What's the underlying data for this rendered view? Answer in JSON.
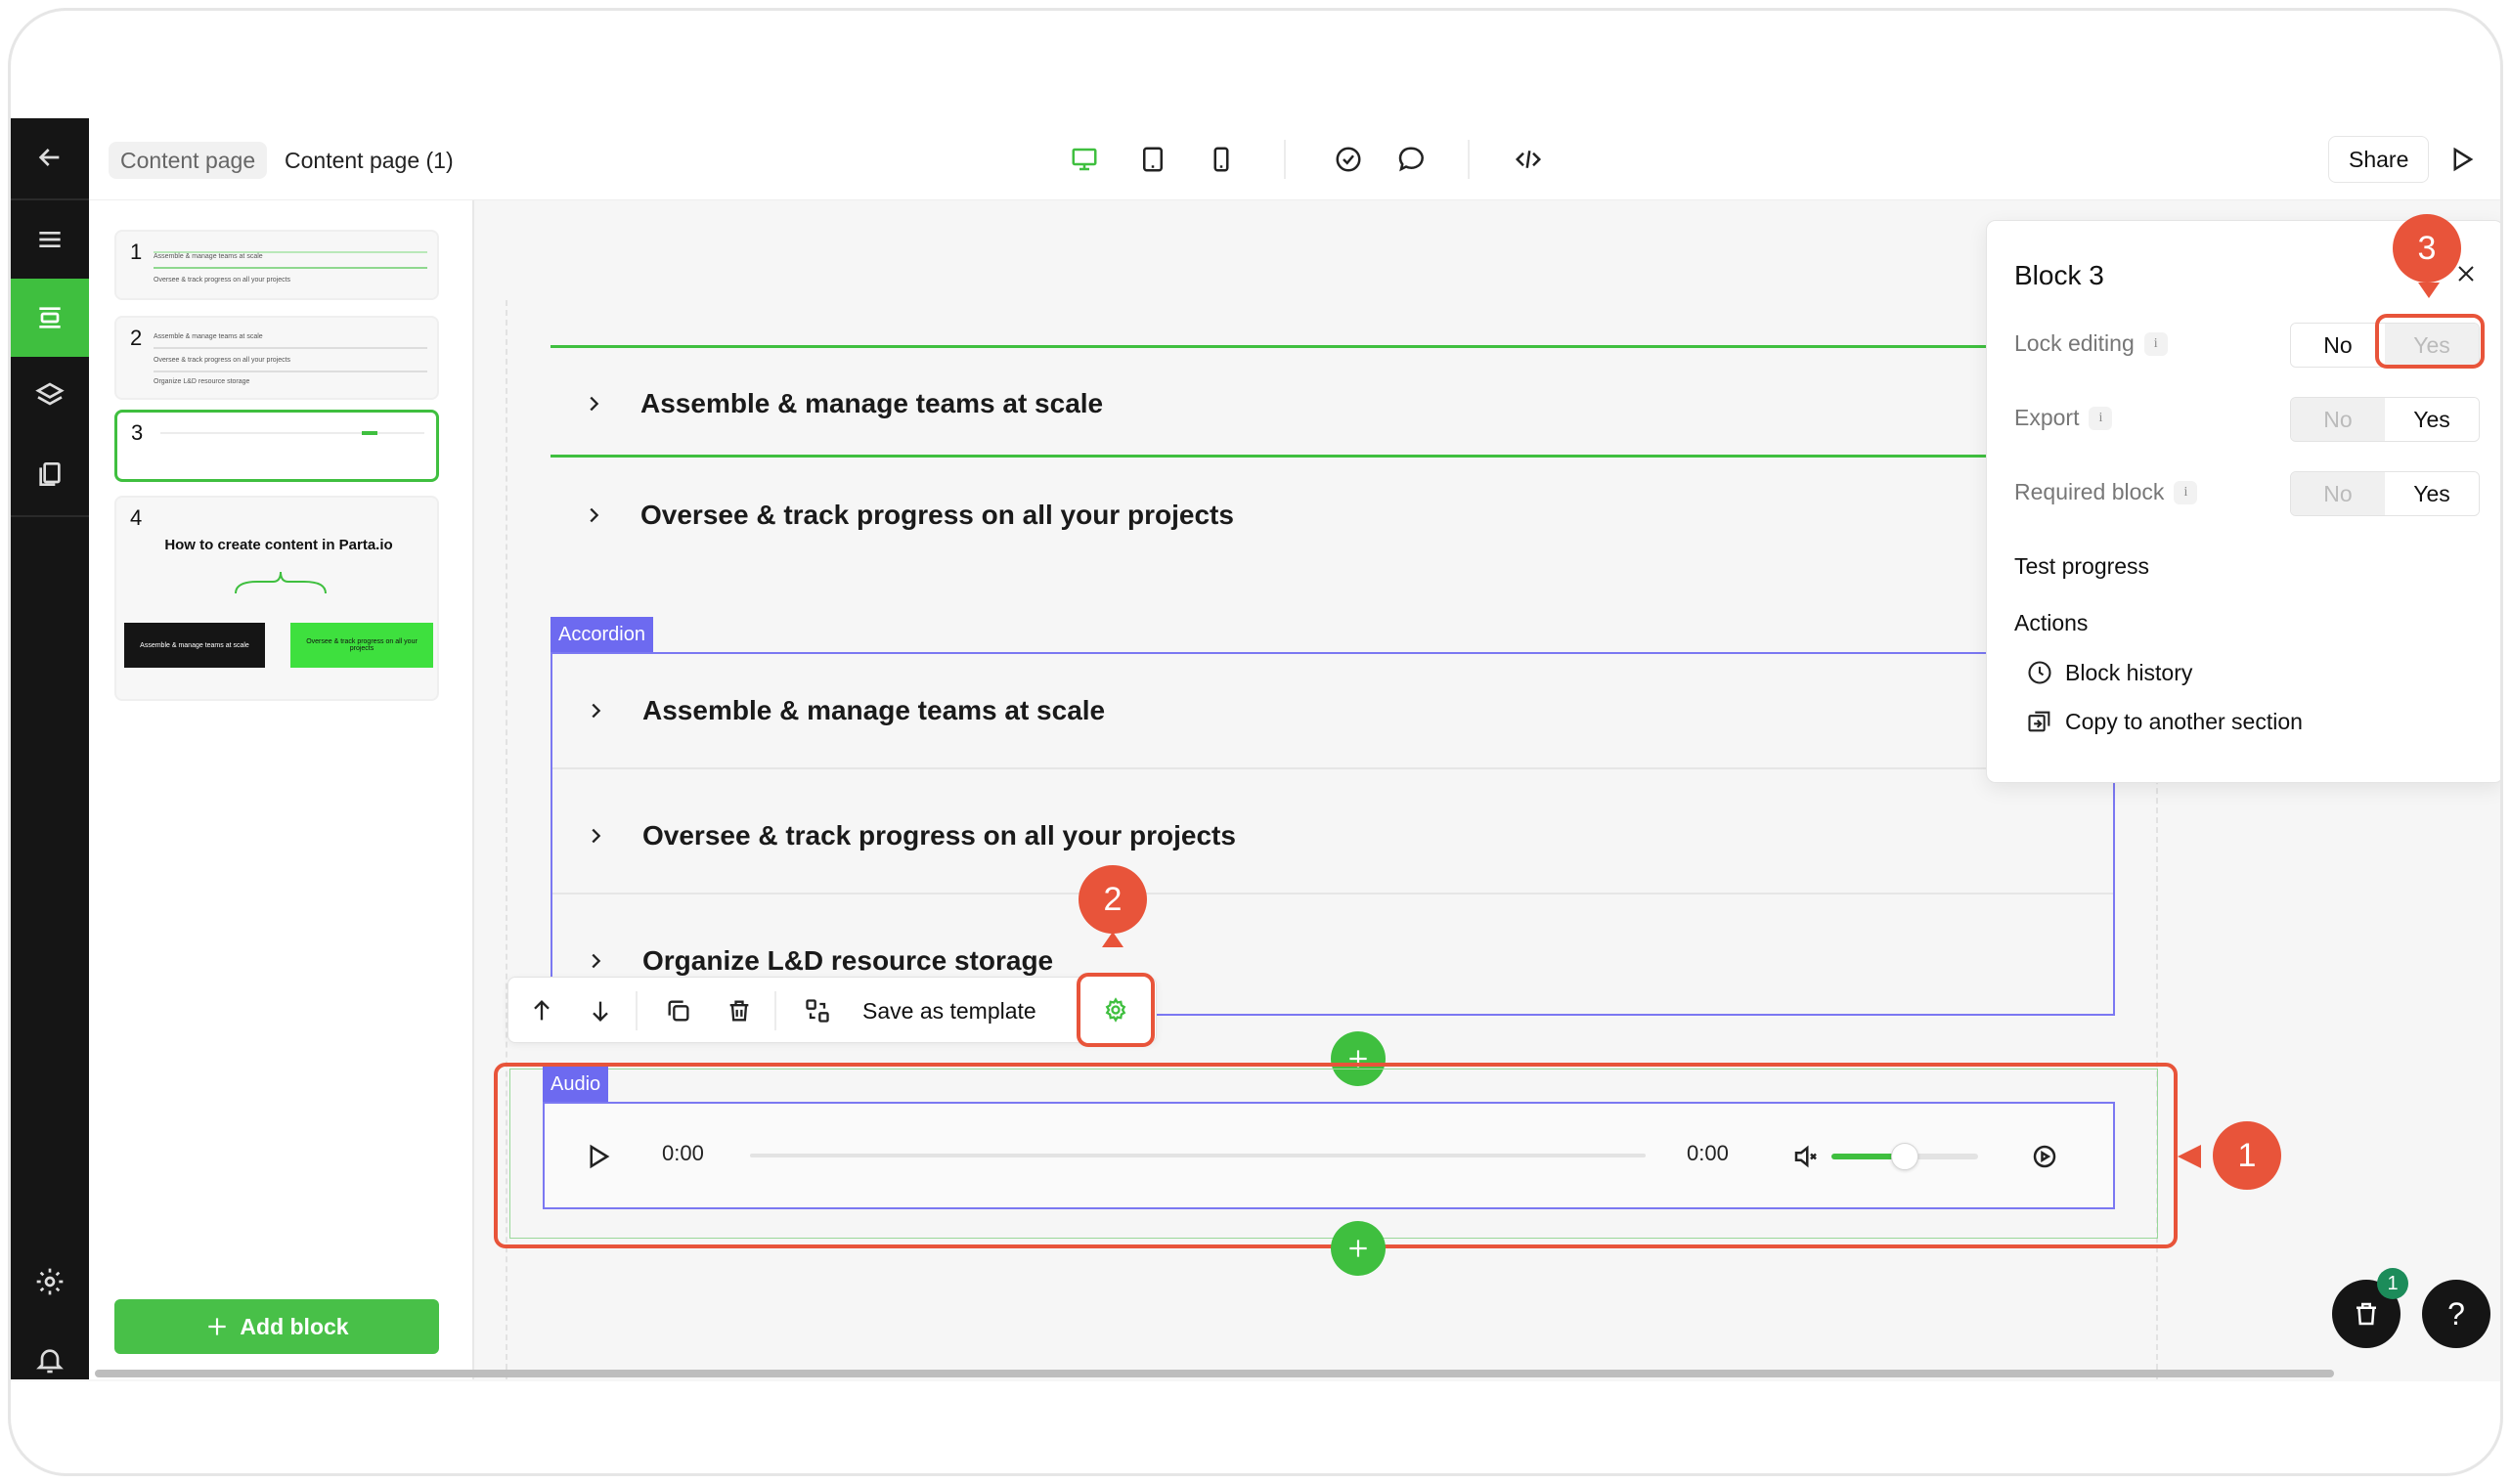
{
  "breadcrumb": {
    "parent": "Content page",
    "current": "Content page (1)"
  },
  "topbar": {
    "share_label": "Share",
    "icons": [
      "desktop-icon",
      "tablet-icon",
      "mobile-icon",
      "check-circle-icon",
      "comment-icon",
      "code-icon",
      "play-icon"
    ]
  },
  "rail": {
    "icons": [
      "back-arrow-icon",
      "menu-icon",
      "blocks-icon",
      "layers-icon",
      "pages-icon",
      "settings-icon",
      "bell-icon"
    ]
  },
  "pages": [
    {
      "num": "1",
      "lines": [
        "Assemble & manage teams at scale",
        "Oversee & track progress on all your projects"
      ]
    },
    {
      "num": "2",
      "lines": [
        "Assemble & manage teams at scale",
        "Oversee & track progress on all your projects",
        "Organize L&D resource storage"
      ]
    },
    {
      "num": "3",
      "lines": []
    },
    {
      "num": "4",
      "heading": "How to create content in Parta.io",
      "cards": [
        "Assemble & manage teams at scale",
        "Oversee & track progress on all your projects"
      ]
    }
  ],
  "add_block_label": "Add block",
  "canvas": {
    "block1": [
      "Assemble & manage teams at scale",
      "Oversee & track progress on all your projects"
    ],
    "accordion_tag": "Accordion",
    "accordion_items": [
      "Assemble & manage teams at scale",
      "Oversee & track progress on all your projects",
      "Organize L&D resource storage"
    ],
    "audio_tag": "Audio",
    "audio": {
      "current_time": "0:00",
      "duration": "0:00",
      "volume": 0.5
    }
  },
  "toolbar": {
    "save_template_label": "Save as template"
  },
  "panel": {
    "title": "Block 3",
    "options": [
      {
        "label": "Lock editing",
        "no": "No",
        "yes": "Yes",
        "selected": "No"
      },
      {
        "label": "Export",
        "no": "No",
        "yes": "Yes",
        "selected": "Yes"
      },
      {
        "label": "Required block",
        "no": "No",
        "yes": "Yes",
        "selected": "Yes"
      }
    ],
    "test_progress": "Test progress",
    "actions_label": "Actions",
    "actions": [
      "Block history",
      "Copy to another section"
    ]
  },
  "annotations": [
    "1",
    "2",
    "3"
  ],
  "notifications": {
    "count": "1",
    "help": "?"
  },
  "colors": {
    "accent": "#3fbf3f",
    "annotation": "#e8543a",
    "block_outline": "#7b78f2",
    "rail": "#151515"
  }
}
